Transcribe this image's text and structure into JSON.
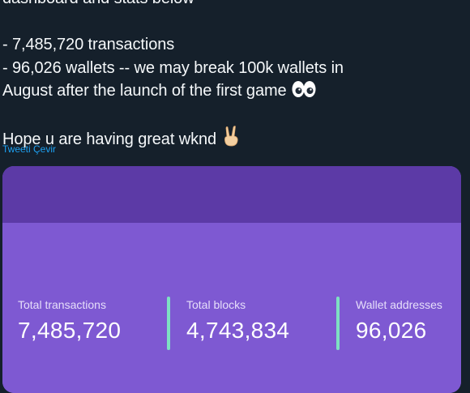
{
  "tweet": {
    "line_top": "dashboard and stats below",
    "line_transactions": "- 7,485,720 transactions",
    "line_wallets_a": "- 96,026 wallets -- we may break 100k wallets in",
    "line_wallets_b": "August after the launch of the first game",
    "line_wkend": "Hope u are having great wknd",
    "translate_link": "Tweeti Çevir"
  },
  "card": {
    "stats": [
      {
        "label": "Total transactions",
        "value": "7,485,720"
      },
      {
        "label": "Total blocks",
        "value": "4,743,834"
      },
      {
        "label": "Wallet addresses",
        "value": "96,026"
      }
    ]
  },
  "icons": {
    "eyes": "eyes-emoji",
    "victory": "victory-hand-emoji"
  },
  "colors": {
    "background": "#15202b",
    "link": "#1da1f2",
    "card_header": "#5c3aa6",
    "card_body": "#7e59d2",
    "divider": "#7ee0c3"
  }
}
